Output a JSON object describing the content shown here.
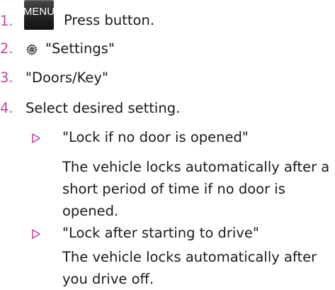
{
  "colors": {
    "number": "#c0479a",
    "arrow": "#c0479a",
    "text": "#1a1a1a"
  },
  "steps": [
    {
      "number": "1.",
      "text": "Press button.",
      "button_label": "MENU"
    },
    {
      "number": "2.",
      "text": "\"Settings\"",
      "icon": "gear-icon"
    },
    {
      "number": "3.",
      "text": "\"Doors/Key\""
    },
    {
      "number": "4.",
      "text": "Select desired setting."
    }
  ],
  "options": [
    {
      "title": "\"Lock if no door is opened\"",
      "description": "The vehicle locks automatically after a short period of time if no door is opened."
    },
    {
      "title": "\"Lock after starting to drive\"",
      "description": "The vehicle locks automatically after you drive off."
    }
  ]
}
